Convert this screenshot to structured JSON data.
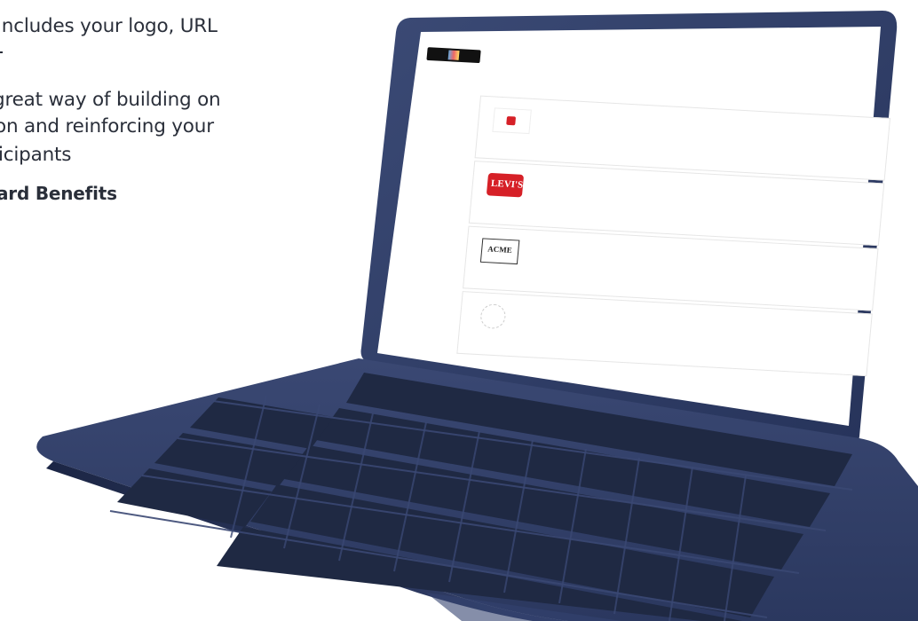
{
  "marketing": {
    "line1": "includes your logo, URL",
    "line2": "n",
    "line3": "great way of building on",
    "line4": "on and reinforcing your",
    "line5": "icipants",
    "heading": "ard Benefits"
  },
  "colors": {
    "laptop_body": "#2f3d63",
    "laptop_body_light": "#3b4a75",
    "keys": "#1f2943",
    "screen_bg": "#ffffff",
    "text": "#2a2f3a",
    "accent_red": "#d62027",
    "accent_blue": "#5a84b5"
  },
  "screen": {
    "brand_logos": [
      {
        "name": "levi's-logo",
        "text": "LEVI'S"
      },
      {
        "name": "acme-logo",
        "text": "ACME"
      }
    ]
  }
}
